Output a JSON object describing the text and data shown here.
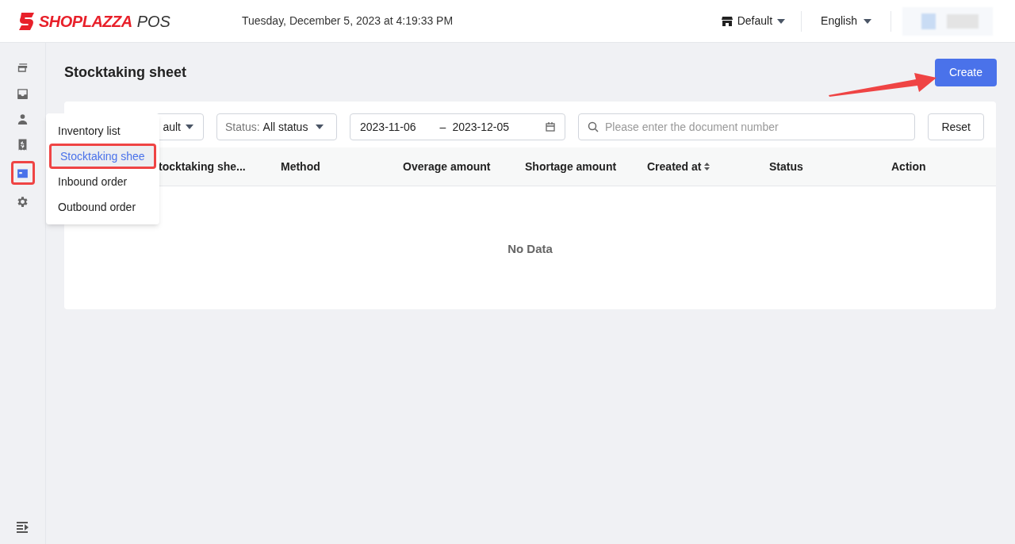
{
  "header": {
    "brand": "SHOPLAZZA",
    "product": "POS",
    "datetime": "Tuesday, December 5, 2023 at 4:19:33 PM",
    "store": "Default",
    "language": "English"
  },
  "sidebar": {
    "items": [
      {
        "kind": "cards",
        "selected": false
      },
      {
        "kind": "inbox",
        "selected": false
      },
      {
        "kind": "person",
        "selected": false
      },
      {
        "kind": "receipt",
        "selected": false
      },
      {
        "kind": "box",
        "selected": true
      },
      {
        "kind": "gear",
        "selected": false
      }
    ]
  },
  "page": {
    "title": "Stocktaking sheet",
    "create_button": "Create"
  },
  "filters": {
    "store_value": "ault",
    "status_label": "Status:",
    "status_value": "All status",
    "date_start": "2023-11-06",
    "date_separator": "–",
    "date_end": "2023-12-05",
    "search_placeholder": "Please enter the document number",
    "reset_button": "Reset"
  },
  "table": {
    "columns": [
      {
        "label": "tocktaking she...",
        "sortable": false
      },
      {
        "label": "Method",
        "sortable": false
      },
      {
        "label": "Overage amount",
        "sortable": false
      },
      {
        "label": "Shortage amount",
        "sortable": false
      },
      {
        "label": "Created at",
        "sortable": true
      },
      {
        "label": "Status",
        "sortable": false
      },
      {
        "label": "Action",
        "sortable": false
      }
    ],
    "empty_text": "No Data"
  },
  "menu": {
    "items": [
      {
        "label": "Inventory list",
        "selected": false
      },
      {
        "label": "Stocktaking shee",
        "selected": true
      },
      {
        "label": "Inbound order",
        "selected": false
      },
      {
        "label": "Outbound order",
        "selected": false
      }
    ]
  }
}
